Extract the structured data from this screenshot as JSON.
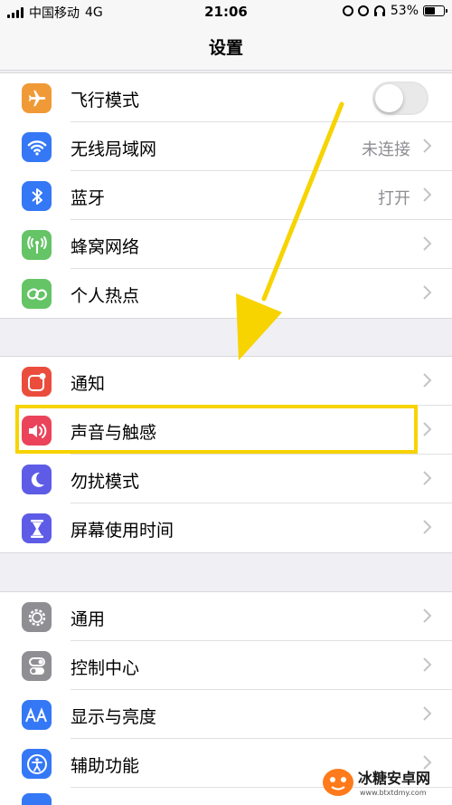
{
  "status_bar": {
    "carrier": "中国移动",
    "network": "4G",
    "time": "21:06",
    "battery": "53%",
    "battery_level": 0.53
  },
  "nav": {
    "title": "设置"
  },
  "groups": [
    {
      "rows": [
        {
          "label": "飞行模式",
          "icon": "airplane-icon",
          "color": "#f09a37",
          "toggle": false
        },
        {
          "label": "无线局域网",
          "icon": "wifi-icon",
          "color": "#3478f6",
          "value": "未连接"
        },
        {
          "label": "蓝牙",
          "icon": "bluetooth-icon",
          "color": "#3478f6",
          "value": "打开"
        },
        {
          "label": "蜂窝网络",
          "icon": "cellular-icon",
          "color": "#65c466"
        },
        {
          "label": "个人热点",
          "icon": "hotspot-icon",
          "color": "#65c466"
        }
      ]
    },
    {
      "rows": [
        {
          "label": "通知",
          "icon": "notification-icon",
          "color": "#eb4d3d"
        },
        {
          "label": "声音与触感",
          "icon": "sound-icon",
          "color": "#eb445a",
          "highlighted": true
        },
        {
          "label": "勿扰模式",
          "icon": "moon-icon",
          "color": "#5e5ce6"
        },
        {
          "label": "屏幕使用时间",
          "icon": "hourglass-icon",
          "color": "#5e5ce6"
        }
      ]
    },
    {
      "rows": [
        {
          "label": "通用",
          "icon": "gear-icon",
          "color": "#8e8e93"
        },
        {
          "label": "控制中心",
          "icon": "switches-icon",
          "color": "#8e8e93"
        },
        {
          "label": "显示与亮度",
          "icon": "text-size-icon",
          "color": "#3478f6"
        },
        {
          "label": "辅助功能",
          "icon": "accessibility-icon",
          "color": "#3478f6"
        }
      ]
    }
  ],
  "annotation": {
    "color": "#f7d300"
  },
  "watermark": {
    "text": "冰糖安卓网",
    "url": "www.btxtdmy.com"
  }
}
